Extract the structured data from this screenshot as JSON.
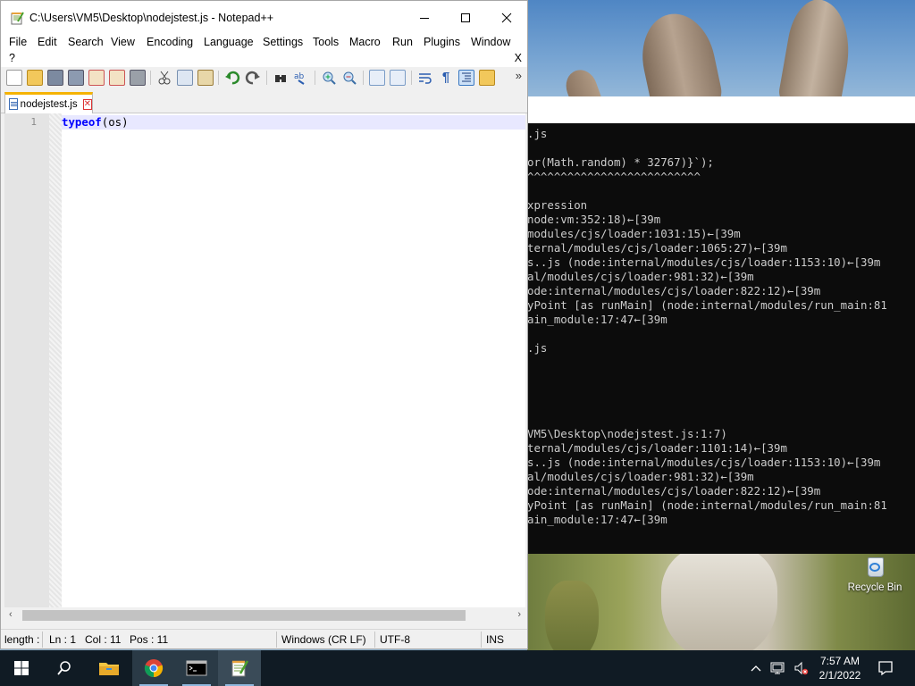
{
  "window": {
    "title": "C:\\Users\\VM5\\Desktop\\nodejstest.js - Notepad++"
  },
  "menu": {
    "items": [
      "File",
      "Edit",
      "Search",
      "View",
      "Encoding",
      "Language",
      "Settings",
      "Tools",
      "Macro",
      "Run",
      "Plugins",
      "Window"
    ],
    "help": "?",
    "close_doc": "X"
  },
  "tab": {
    "label": "nodejstest.js"
  },
  "editor": {
    "line_numbers": [
      "1"
    ],
    "code_keyword": "typeof",
    "code_rest": "(os)"
  },
  "statusbar": {
    "length": "length :",
    "ln": "Ln : 1",
    "col": "Col : 11",
    "pos": "Pos : 11",
    "eol": "Windows (CR LF)",
    "encoding": "UTF-8",
    "mode": "INS"
  },
  "terminal": {
    "lines": [
      ".js",
      "",
      "or(Math.random) * 32767)}`);",
      "^^^^^^^^^^^^^^^^^^^^^^^^^^",
      "",
      "xpression",
      "node:vm:352:18)←[39m",
      "modules/cjs/loader:1031:15)←[39m",
      "ternal/modules/cjs/loader:1065:27)←[39m",
      "s..js (node:internal/modules/cjs/loader:1153:10)←[39m",
      "al/modules/cjs/loader:981:32)←[39m",
      "ode:internal/modules/cjs/loader:822:12)←[39m",
      "yPoint [as runMain] (node:internal/modules/run_main:81",
      "ain_module:17:47←[39m",
      "",
      ".js",
      "",
      "",
      "",
      "",
      "",
      "VM5\\Desktop\\nodejstest.js:1:7)",
      "ternal/modules/cjs/loader:1101:14)←[39m",
      "s..js (node:internal/modules/cjs/loader:1153:10)←[39m",
      "al/modules/cjs/loader:981:32)←[39m",
      "ode:internal/modules/cjs/loader:822:12)←[39m",
      "yPoint [as runMain] (node:internal/modules/run_main:81",
      "ain_module:17:47←[39m"
    ]
  },
  "desktop": {
    "recycle_bin_label": "Recycle Bin"
  },
  "taskbar": {
    "time": "7:57 AM",
    "date": "2/1/2022",
    "pinned": [
      "start-icon",
      "search-icon",
      "file-explorer-icon",
      "chrome-icon",
      "command-prompt-icon",
      "notepad-plus-plus-icon"
    ]
  },
  "colors": {
    "keyword": "#0000ff",
    "current_line": "#e8e8ff",
    "tab_accent": "#f5b300",
    "taskbar": "#101b24",
    "terminal_bg": "#0c0c0c",
    "terminal_text": "#cccccc"
  }
}
